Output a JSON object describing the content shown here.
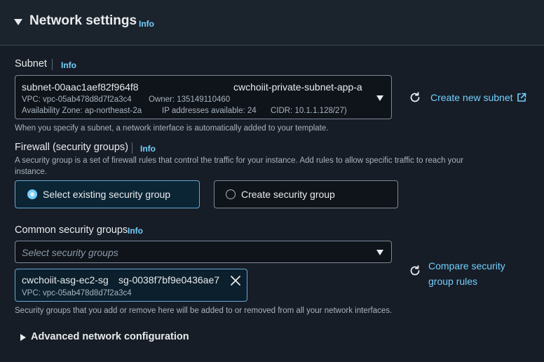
{
  "section": {
    "title": "Network settings",
    "info": "Info"
  },
  "subnet": {
    "label": "Subnet",
    "info": "Info",
    "selected_id": "subnet-00aac1aef82f964f8",
    "selected_name": "cwchoiit-private-subnet-app-a",
    "vpc": "VPC: vpc-05ab478d8d7f2a3c4",
    "owner": "Owner: 135149110460",
    "az": "Availability Zone: ap-northeast-2a",
    "ips": "IP addresses available: 24",
    "cidr": "CIDR: 10.1.1.128/27)",
    "create_link": "Create new subnet",
    "hint": "When you specify a subnet, a network interface is automatically added to your template."
  },
  "firewall": {
    "label": "Firewall (security groups)",
    "info": "Info",
    "description_line1": "A security group is a set of firewall rules that control the traffic for your instance. Add rules to allow specific traffic to reach your",
    "description_line2": "instance.",
    "options": [
      {
        "label": "Select existing security group",
        "selected": true
      },
      {
        "label": "Create security group",
        "selected": false
      }
    ]
  },
  "common_sg": {
    "label": "Common security groups",
    "info": "Info",
    "placeholder": "Select security groups",
    "compare_link_line1": "Compare security",
    "compare_link_line2": "group rules",
    "selected_token": {
      "name": "cwchoiit-asg-ec2-sg",
      "id": "sg-0038f7bf9e0436ae7",
      "vpc": "VPC: vpc-05ab478d8d7f2a3c4"
    },
    "hint": "Security groups that you add or remove here will be added to or removed from all your network interfaces."
  },
  "advanced": {
    "label": "Advanced network configuration"
  },
  "colors": {
    "background": "#161d26",
    "link": "#75cfff",
    "selected_border": "#6aa7d4",
    "text": "#e9ebed",
    "muted": "#a9b3bf"
  }
}
